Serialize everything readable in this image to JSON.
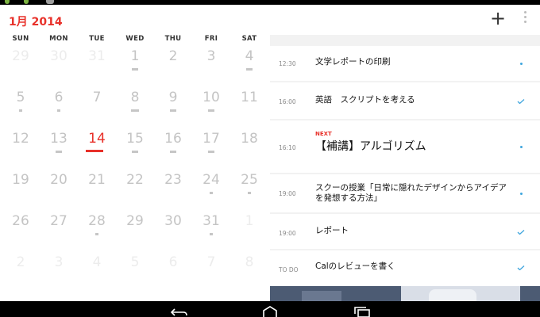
{
  "header": {
    "month_title": "1月 2014",
    "add_label": "+"
  },
  "weekdays": [
    "SUN",
    "MON",
    "TUE",
    "WED",
    "THU",
    "FRI",
    "SAT"
  ],
  "calendar": {
    "weeks": [
      [
        "29",
        "30",
        "31",
        "1",
        "2",
        "3",
        "4"
      ],
      [
        "5",
        "6",
        "7",
        "8",
        "9",
        "10",
        "11"
      ],
      [
        "12",
        "13",
        "14",
        "15",
        "16",
        "17",
        "18"
      ],
      [
        "19",
        "20",
        "21",
        "22",
        "23",
        "24",
        "25"
      ],
      [
        "26",
        "27",
        "28",
        "29",
        "30",
        "31",
        "1"
      ],
      [
        "2",
        "3",
        "4",
        "5",
        "6",
        "7",
        "8"
      ]
    ],
    "today": "14"
  },
  "agenda": [
    {
      "time": "12:30",
      "title": "文学レポートの印刷",
      "status": "dot"
    },
    {
      "time": "16:00",
      "title": "英語　スクリプトを考える",
      "status": "check"
    },
    {
      "time": "16:10",
      "label": "NEXT",
      "title": "【補講】アルゴリズム",
      "status": "dot"
    },
    {
      "time": "19:00",
      "title": "スクーの授業「日常に隠れたデザインからアイデアを発想する方法」",
      "status": "dot"
    },
    {
      "time": "19:00",
      "title": "レポート",
      "status": "check"
    },
    {
      "time": "TO DO",
      "title": "Calのレビューを書く",
      "status": "check"
    }
  ],
  "colors": {
    "accent": "#e8312a",
    "check": "#40a6de"
  }
}
